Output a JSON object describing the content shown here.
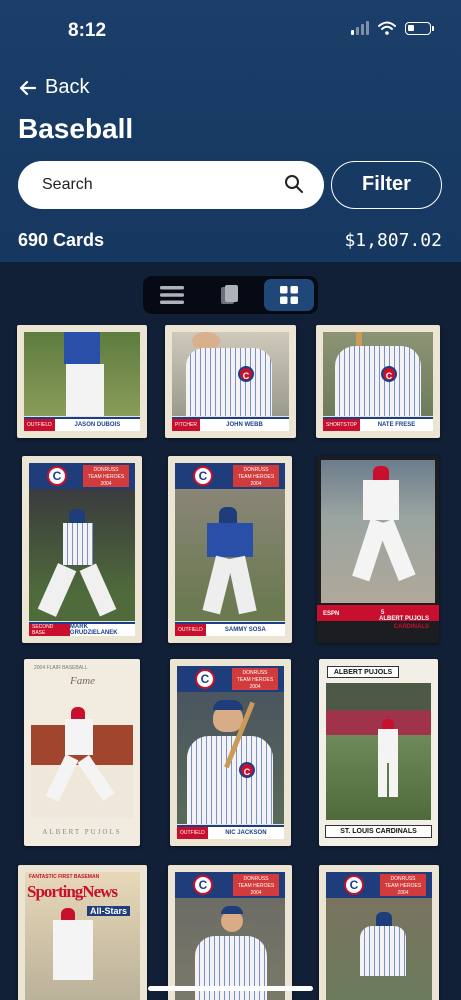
{
  "status": {
    "time": "8:12"
  },
  "nav": {
    "back_label": "Back"
  },
  "page": {
    "title": "Baseball"
  },
  "search": {
    "placeholder": "Search"
  },
  "filter": {
    "label": "Filter"
  },
  "summary": {
    "count": "690 Cards",
    "total": "$1,807.02"
  },
  "view_modes": [
    {
      "name": "list-view",
      "icon": "list-icon",
      "active": false
    },
    {
      "name": "card-stack-view",
      "icon": "cards-icon",
      "active": false
    },
    {
      "name": "grid-view",
      "icon": "grid-icon",
      "active": true
    }
  ],
  "cards": {
    "r1c1": {
      "pos": "OUTFIELD",
      "name": "JASON DUBOIS"
    },
    "r1c2": {
      "pos": "PITCHER",
      "name": "JOHN WEBB"
    },
    "r1c3": {
      "pos": "SHORTSTOP",
      "name": "NATE FRESE"
    },
    "r2c1": {
      "pos": "SECOND BASE",
      "name": "MARK GRUDZIELANEK",
      "brand": "DONRUSS",
      "sub": "TEAM HEROES",
      "year": "2004"
    },
    "r2c2": {
      "pos": "OUTFIELD",
      "name": "SAMMY SOSA",
      "brand": "DONRUSS",
      "sub": "TEAM HEROES",
      "year": "2004"
    },
    "r2c3": {
      "pos": "5",
      "name": "ALBERT PUJOLS",
      "team": "CARDINALS",
      "brand": "ESPN"
    },
    "r3c1": {
      "name": "ALBERT PUJOLS",
      "top": "2004 FLAIR BASEBALL",
      "brand": "Fame"
    },
    "r3c2": {
      "pos": "OUTFIELD",
      "name": "NIC JACKSON",
      "brand": "DONRUSS",
      "sub": "TEAM HEROES",
      "year": "2004"
    },
    "r3c3": {
      "name": "ALBERT PUJOLS",
      "team": "ST. LOUIS CARDINALS"
    },
    "r4c1": {
      "top": "FANTASTIC FIRST BASEMAN",
      "brand": "SportingNews",
      "sub": "All-Stars"
    },
    "r4c2": {
      "brand": "DONRUSS",
      "sub": "TEAM HEROES",
      "year": "2004"
    },
    "r4c3": {
      "brand": "DONRUSS",
      "sub": "TEAM HEROES",
      "year": "2004"
    }
  },
  "colors": {
    "header": "#1b3f6a",
    "background": "#112036",
    "accent": "#1f4878"
  }
}
